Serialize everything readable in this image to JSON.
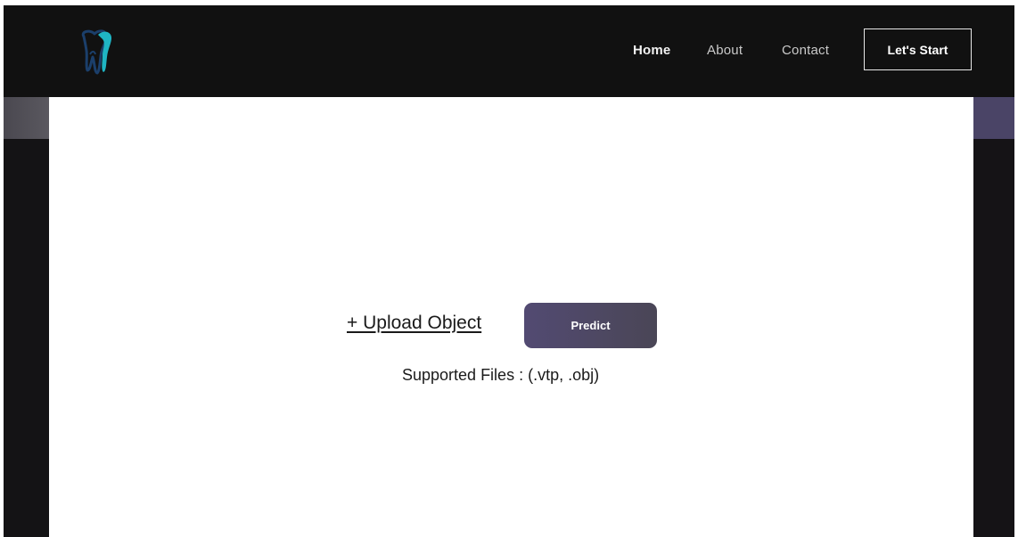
{
  "navbar": {
    "logo_icon": "tooth-icon",
    "links": [
      {
        "label": "Home"
      },
      {
        "label": "About"
      },
      {
        "label": "Contact"
      }
    ],
    "cta_label": "Let's Start"
  },
  "main": {
    "upload_label": "+ Upload Object",
    "predict_label": "Predict",
    "supported_text": "Supported Files : (.vtp, .obj)"
  },
  "colors": {
    "navbar_bg": "#111111",
    "predict_button": "#524a72",
    "logo_teal": "#1fb5c4",
    "logo_dark": "#1b3f6b"
  }
}
